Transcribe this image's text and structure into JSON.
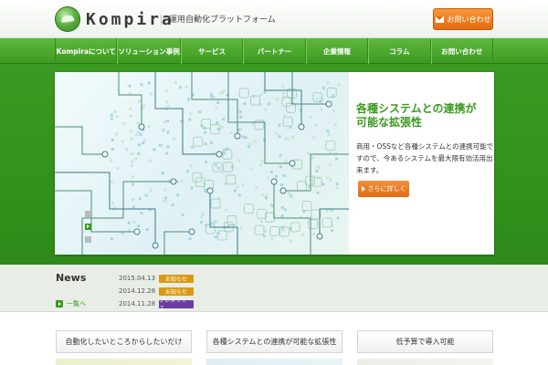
{
  "header": {
    "logo_text": "Kompira",
    "tagline": "運用自動化プラットフォーム",
    "contact_label": "お問い合わせ",
    "contact_icon": "mail-icon"
  },
  "nav": {
    "items": [
      {
        "label": "Kompiraについて"
      },
      {
        "label": "ソリューション事例"
      },
      {
        "label": "サービス"
      },
      {
        "label": "パートナー"
      },
      {
        "label": "企業情報"
      },
      {
        "label": "コラム"
      },
      {
        "label": "お問い合わせ"
      }
    ]
  },
  "hero": {
    "title_line1": "各種システムとの連携が",
    "title_line2": "可能な拡張性",
    "description": "商用・OSSなど各種システムとの連携可能ですので、今あるシステムを最大限有効活用出来ます。",
    "more_label": "さらに詳しく",
    "slides": [
      {
        "label": "",
        "active": false
      },
      {
        "label": "",
        "active": true
      },
      {
        "label": "",
        "active": false
      }
    ]
  },
  "news": {
    "title": "News",
    "list_label": "一覧へ",
    "items": [
      {
        "date": "2015.04.13",
        "badge": "お知らせ",
        "badge_color": "#d99a11",
        "text": ""
      },
      {
        "date": "2014.12.28",
        "badge": "お知らせ",
        "badge_color": "#d99a11",
        "text": ""
      },
      {
        "date": "2014.11.28",
        "badge": "プレスリリース",
        "badge_color": "#6a3fa3",
        "text": ""
      }
    ]
  },
  "features": [
    {
      "label": "自動化したいところからしたいだけ"
    },
    {
      "label": "各種システムとの連携が可能な拡張性"
    },
    {
      "label": "低予算で導入可能"
    }
  ],
  "colors": {
    "brand_green": "#3a9a1e",
    "accent_orange": "#e86f14"
  }
}
